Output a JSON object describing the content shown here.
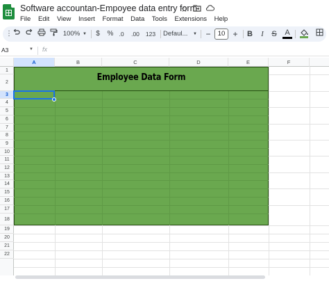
{
  "window": {
    "title": "Software accountan-Empoyee data entry form",
    "icons": [
      "star-icon",
      "move-to-folder-icon",
      "cloud-status-icon"
    ]
  },
  "menu": [
    "File",
    "Edit",
    "View",
    "Insert",
    "Format",
    "Data",
    "Tools",
    "Extensions",
    "Help"
  ],
  "toolbar": {
    "zoom": "100%",
    "currency": "$",
    "percent": "%",
    "decrease_decimals": ".0",
    "increase_decimals": ".00",
    "number_format": "123",
    "font": "Defaul...",
    "font_size": "10",
    "font_size_minus": "−",
    "font_size_plus": "+",
    "bold": "B",
    "italic": "I",
    "strike": "S",
    "text_color": "A"
  },
  "formula_bar": {
    "cell_ref": "A3",
    "fx": "fx",
    "value": ""
  },
  "grid": {
    "columns": [
      "A",
      "B",
      "C",
      "D",
      "E",
      "F"
    ],
    "rows": [
      "1",
      "2",
      "3",
      "4",
      "5",
      "6",
      "7",
      "8",
      "9",
      "10",
      "11",
      "12",
      "13",
      "14",
      "15",
      "16",
      "17",
      "18",
      "19",
      "20",
      "21",
      "22"
    ],
    "selected_cell": "A3",
    "merged_title": "Employee Data Form",
    "fill_color": "#6aa84f",
    "border_color": "#274e13"
  },
  "colors": {
    "accent": "#1a73e8",
    "toolbar_bg": "#eef2f9",
    "header_selected": "#d3e3fd"
  }
}
